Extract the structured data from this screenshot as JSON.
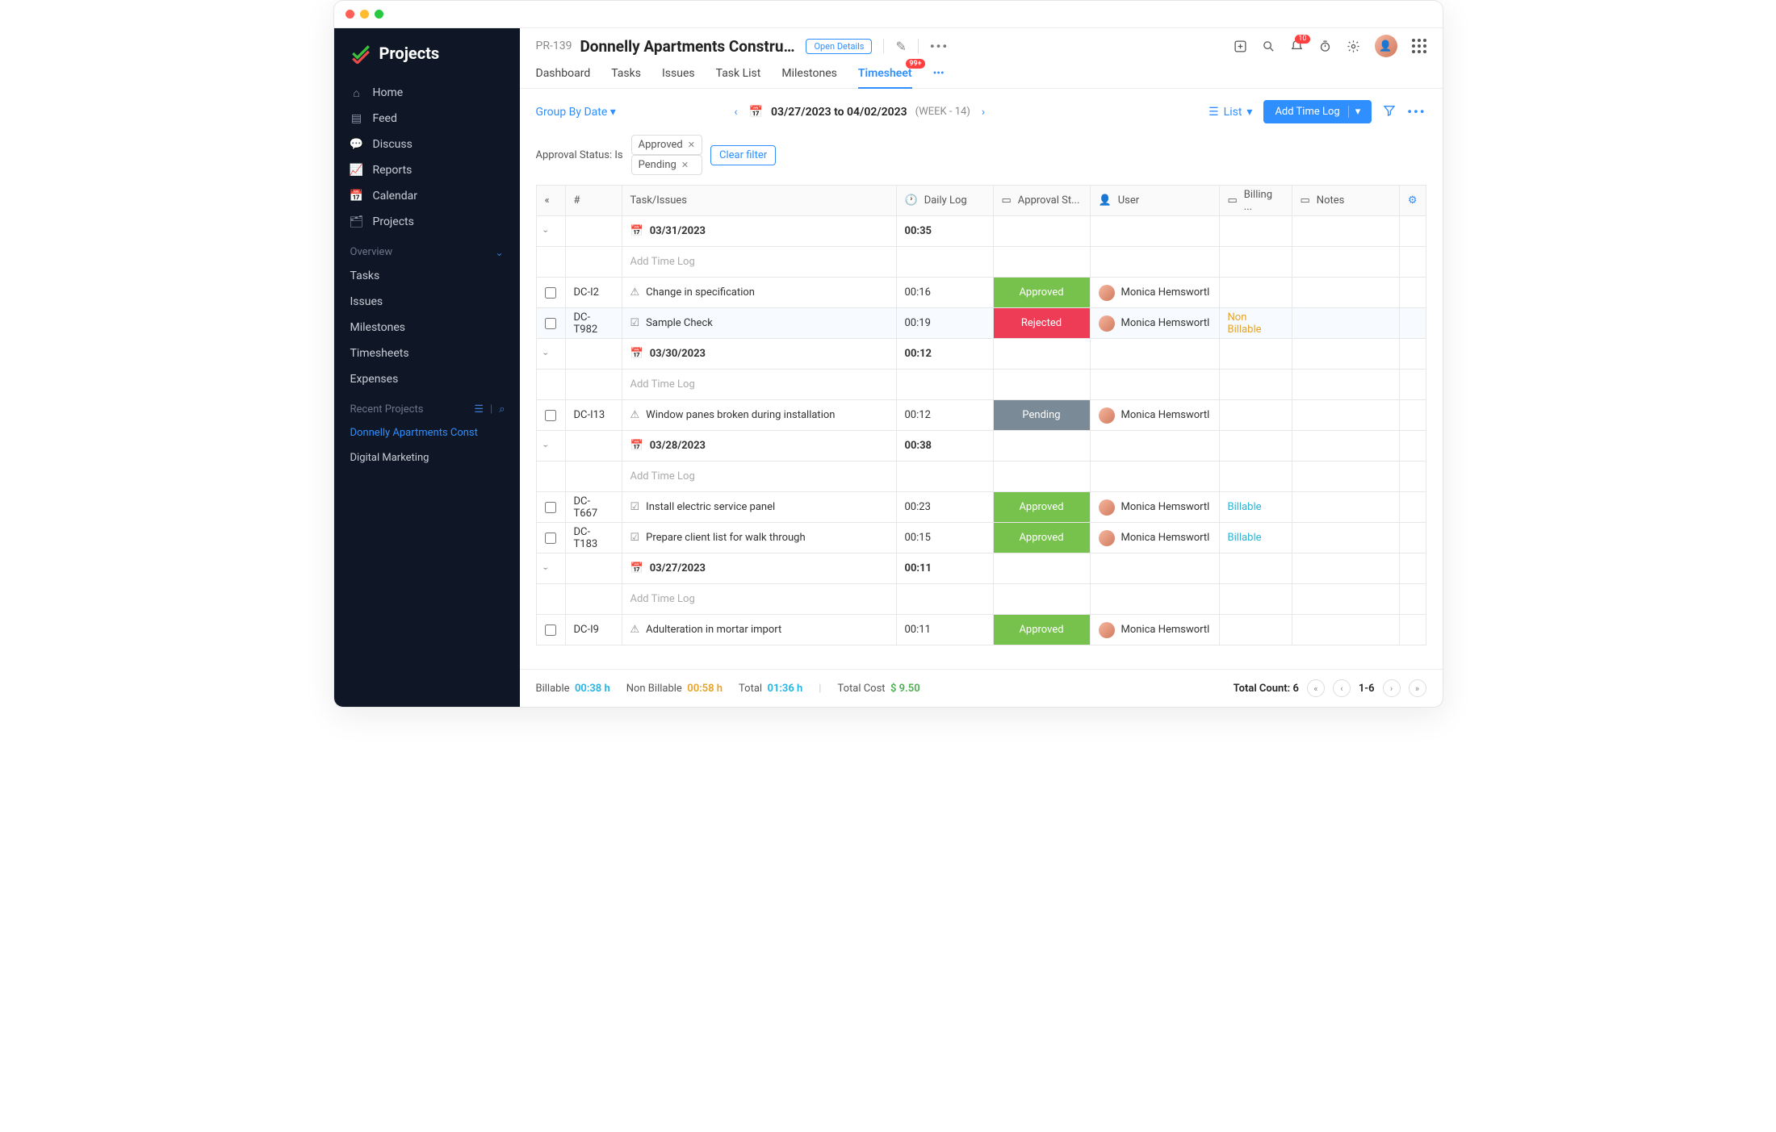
{
  "brand": "Projects",
  "sidebar": {
    "nav": [
      {
        "icon": "home",
        "label": "Home"
      },
      {
        "icon": "feed",
        "label": "Feed"
      },
      {
        "icon": "discuss",
        "label": "Discuss"
      },
      {
        "icon": "reports",
        "label": "Reports"
      },
      {
        "icon": "calendar",
        "label": "Calendar"
      },
      {
        "icon": "projects",
        "label": "Projects"
      }
    ],
    "overview_label": "Overview",
    "overview_items": [
      "Tasks",
      "Issues",
      "Milestones",
      "Timesheets",
      "Expenses"
    ],
    "recent_label": "Recent Projects",
    "recent_items": [
      {
        "label": "Donnelly Apartments Const",
        "active": true
      },
      {
        "label": "Digital Marketing",
        "active": false
      }
    ]
  },
  "header": {
    "proj_id": "PR-139",
    "proj_name": "Donnelly Apartments Constructic",
    "open_details": "Open Details",
    "bell_badge": "10",
    "tabs": [
      "Dashboard",
      "Tasks",
      "Issues",
      "Task List",
      "Milestones",
      "Timesheet"
    ],
    "active_tab": 5,
    "timesheet_badge": "99+"
  },
  "toolbar": {
    "groupby": "Group By Date",
    "date_range": "03/27/2023 to 04/02/2023",
    "week": "(WEEK - 14)",
    "view": "List",
    "add_btn": "Add Time Log"
  },
  "filterbar": {
    "label": "Approval Status: Is",
    "chips": [
      "Approved",
      "Pending"
    ],
    "clear": "Clear filter"
  },
  "columns": {
    "num": "#",
    "task": "Task/Issues",
    "daily": "Daily Log",
    "approval": "Approval St...",
    "user": "User",
    "billing": "Billing ...",
    "notes": "Notes"
  },
  "rows": [
    {
      "type": "date",
      "date": "03/31/2023",
      "total": "00:35"
    },
    {
      "type": "addlog",
      "label": "Add Time Log"
    },
    {
      "type": "entry",
      "num": "DC-I2",
      "kind": "issue",
      "task": "Change in specification",
      "daily": "00:16",
      "status": "Approved",
      "status_cls": "status-approved",
      "user": "Monica Hemswortl",
      "billing": ""
    },
    {
      "type": "entry",
      "num": "DC-T982",
      "kind": "task",
      "task": "Sample Check",
      "daily": "00:19",
      "status": "Rejected",
      "status_cls": "status-rejected",
      "user": "Monica Hemswortl",
      "billing": "Non Billable",
      "billing_cls": "nonbillable",
      "highlight": true
    },
    {
      "type": "date",
      "date": "03/30/2023",
      "total": "00:12"
    },
    {
      "type": "addlog",
      "label": "Add Time Log"
    },
    {
      "type": "entry",
      "num": "DC-I13",
      "kind": "issue",
      "task": "Window panes broken during installation",
      "daily": "00:12",
      "status": "Pending",
      "status_cls": "status-pending",
      "user": "Monica Hemswortl",
      "billing": ""
    },
    {
      "type": "date",
      "date": "03/28/2023",
      "total": "00:38"
    },
    {
      "type": "addlog",
      "label": "Add Time Log"
    },
    {
      "type": "entry",
      "num": "DC-T667",
      "kind": "task",
      "task": "Install electric service panel",
      "daily": "00:23",
      "status": "Approved",
      "status_cls": "status-approved",
      "user": "Monica Hemswortl",
      "billing": "Billable",
      "billing_cls": "billable"
    },
    {
      "type": "entry",
      "num": "DC-T183",
      "kind": "task",
      "task": "Prepare client list for walk through",
      "daily": "00:15",
      "status": "Approved",
      "status_cls": "status-approved",
      "user": "Monica Hemswortl",
      "billing": "Billable",
      "billing_cls": "billable"
    },
    {
      "type": "date",
      "date": "03/27/2023",
      "total": "00:11"
    },
    {
      "type": "addlog",
      "label": "Add Time Log"
    },
    {
      "type": "entry",
      "num": "DC-I9",
      "kind": "issue",
      "task": "Adulteration in mortar import",
      "daily": "00:11",
      "status": "Approved",
      "status_cls": "status-approved",
      "user": "Monica Hemswortl",
      "billing": ""
    }
  ],
  "footer": {
    "billable_label": "Billable",
    "billable_val": "00:38 h",
    "nonbillable_label": "Non Billable",
    "nonbillable_val": "00:58 h",
    "total_label": "Total",
    "total_val": "01:36 h",
    "totalcost_label": "Total Cost",
    "totalcost_val": "$ 9.50",
    "count_label": "Total Count: 6",
    "range": "1-6"
  }
}
